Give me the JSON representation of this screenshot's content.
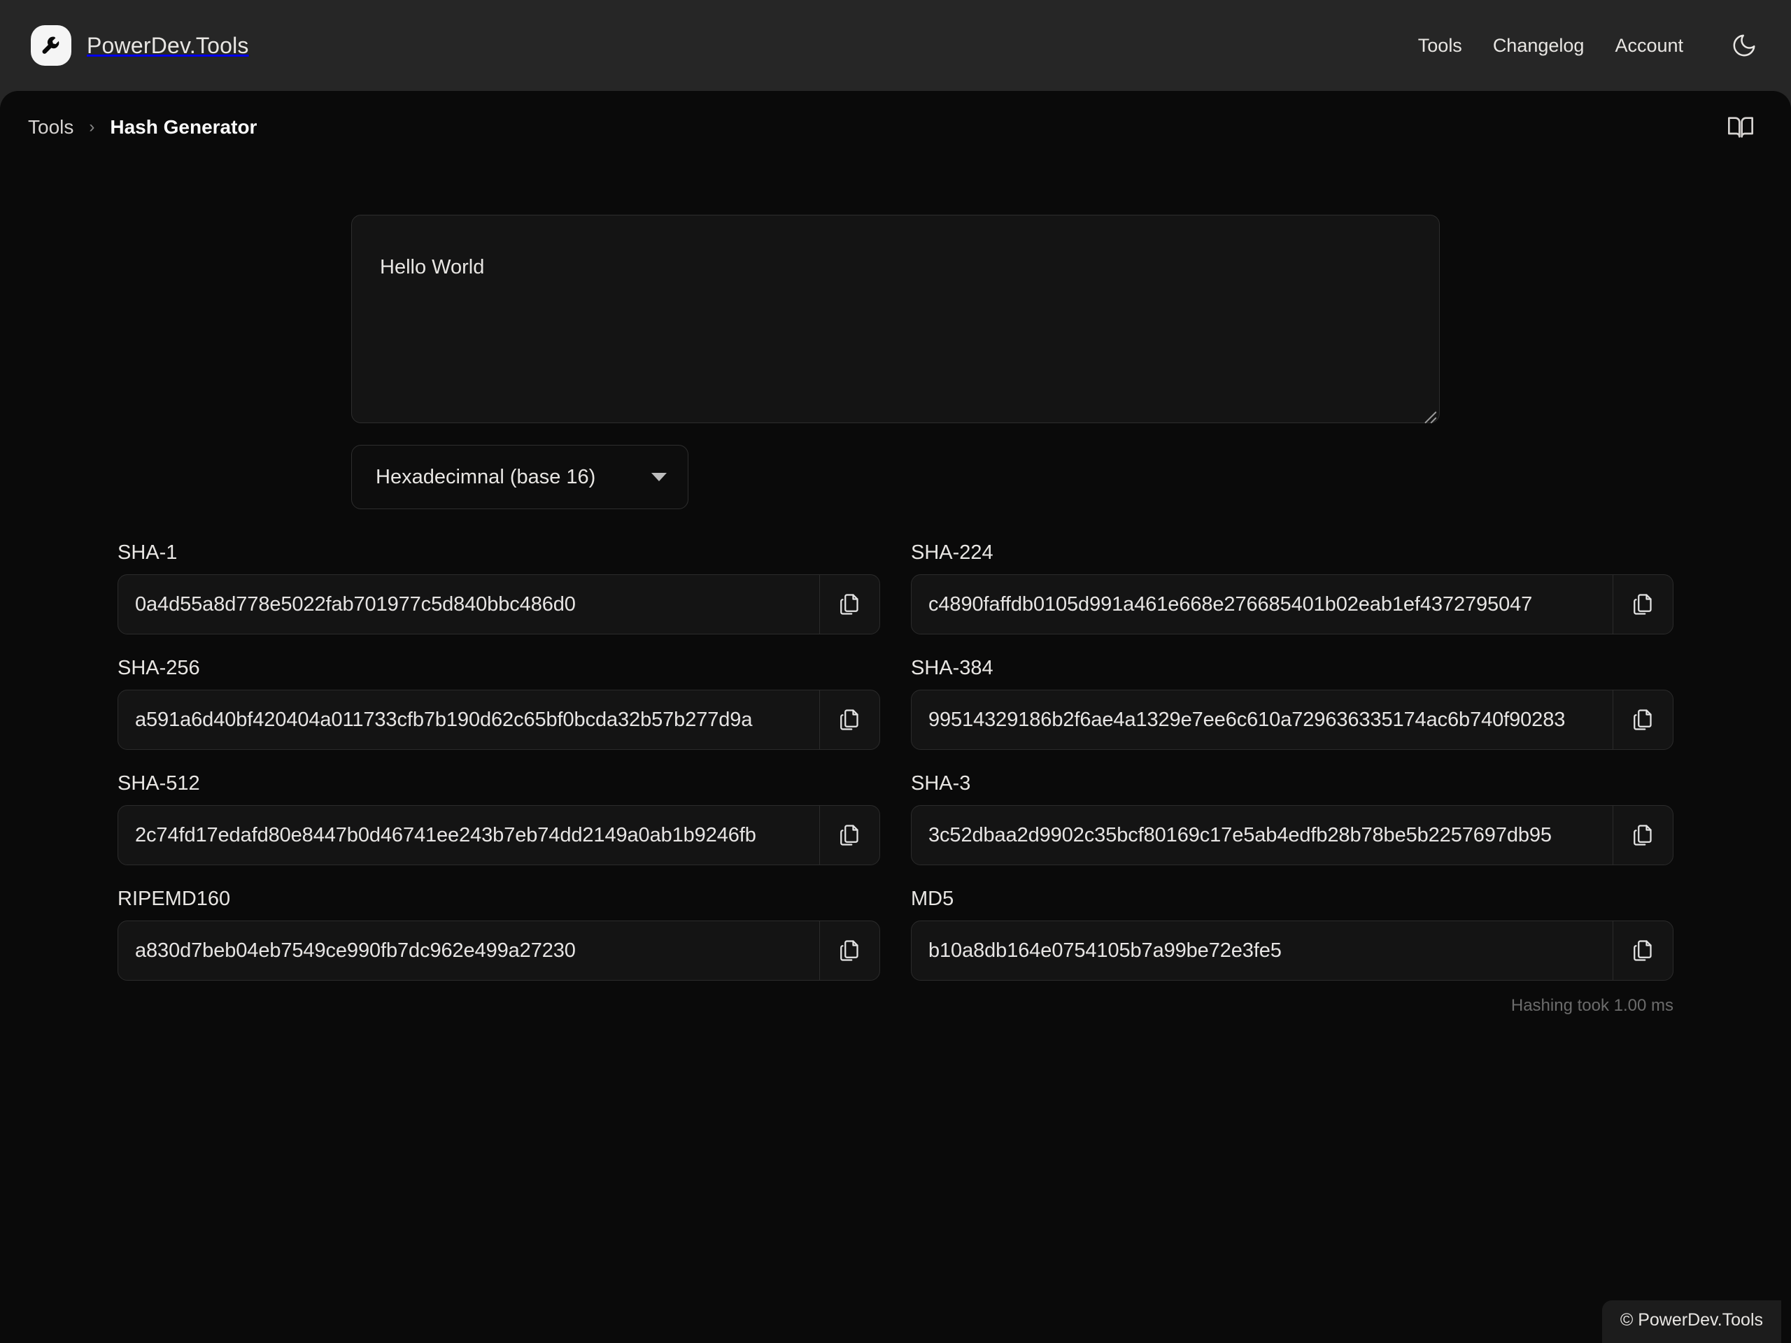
{
  "site": {
    "brand": "PowerDev.Tools",
    "logo_icon": "wrench-icon",
    "footer": "© PowerDev.Tools"
  },
  "nav": {
    "links": [
      {
        "label": "Tools"
      },
      {
        "label": "Changelog"
      },
      {
        "label": "Account"
      }
    ],
    "theme_toggle_icon": "moon-icon"
  },
  "breadcrumb": {
    "parent": "Tools",
    "separator": "›",
    "current": "Hash Generator",
    "docs_icon": "book-icon"
  },
  "input": {
    "value": "Hello World",
    "placeholder": ""
  },
  "format": {
    "selected": "Hexadecimnal (base 16)",
    "caret_icon": "chevron-down-icon"
  },
  "hashes": [
    {
      "label": "SHA-1",
      "value": "0a4d55a8d778e5022fab701977c5d840bbc486d0",
      "copy_icon": "copy-icon"
    },
    {
      "label": "SHA-224",
      "value": "c4890faffdb0105d991a461e668e276685401b02eab1ef4372795047",
      "copy_icon": "copy-icon"
    },
    {
      "label": "SHA-256",
      "value": "a591a6d40bf420404a011733cfb7b190d62c65bf0bcda32b57b277d9a",
      "copy_icon": "copy-icon"
    },
    {
      "label": "SHA-384",
      "value": "99514329186b2f6ae4a1329e7ee6c610a729636335174ac6b740f90283",
      "copy_icon": "copy-icon"
    },
    {
      "label": "SHA-512",
      "value": "2c74fd17edafd80e8447b0d46741ee243b7eb74dd2149a0ab1b9246fb",
      "copy_icon": "copy-icon"
    },
    {
      "label": "SHA-3",
      "value": "3c52dbaa2d9902c35bcf80169c17e5ab4edfb28b78be5b2257697db95",
      "copy_icon": "copy-icon"
    },
    {
      "label": "RIPEMD160",
      "value": "a830d7beb04eb7549ce990fb7dc962e499a27230",
      "copy_icon": "copy-icon"
    },
    {
      "label": "MD5",
      "value": "b10a8db164e0754105b7a99be72e3fe5",
      "copy_icon": "copy-icon"
    }
  ],
  "status": {
    "timing": "Hashing took 1.00 ms"
  },
  "colors": {
    "header_bg": "#262626",
    "panel_bg": "#0a0a0a",
    "field_bg": "#141414",
    "border": "#2b2b2b",
    "text": "#e8e6e3",
    "muted": "#6b6b6b"
  }
}
